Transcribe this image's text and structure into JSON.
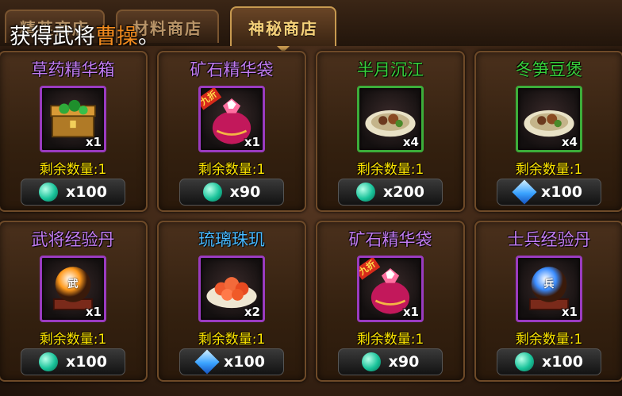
{
  "tabs": [
    "精英商店",
    "材料商店",
    "神秘商店"
  ],
  "toast": {
    "prefix": "获得武将",
    "highlight": "曹操",
    "suffix": "。"
  },
  "colors": {
    "purple": "#c27cf2",
    "green": "#39d13c",
    "blue": "#49b9ff",
    "remain": "#ffe600",
    "highlight": "#f08a1e"
  },
  "items": [
    {
      "name": "草药精华箱",
      "name_color": "#c27cf2",
      "qty": "x1",
      "remain": "剩余数量:1",
      "price": "x100",
      "currency": "jade-icon",
      "frame": "purple",
      "badge": "",
      "art": "chest-icon"
    },
    {
      "name": "矿石精华袋",
      "name_color": "#c27cf2",
      "qty": "x1",
      "remain": "剩余数量:1",
      "price": "x90",
      "currency": "jade-icon",
      "frame": "purple",
      "badge": "九折",
      "art": "bag-icon"
    },
    {
      "name": "半月沉江",
      "name_color": "#39d13c",
      "qty": "x4",
      "remain": "剩余数量:1",
      "price": "x200",
      "currency": "jade-icon",
      "frame": "green",
      "badge": "",
      "art": "dish-icon"
    },
    {
      "name": "冬笋豆煲",
      "name_color": "#39d13c",
      "qty": "x4",
      "remain": "剩余数量:1",
      "price": "x100",
      "currency": "gem-icon",
      "frame": "green",
      "badge": "",
      "art": "dish-icon"
    },
    {
      "name": "武将经验丹",
      "name_color": "#c27cf2",
      "qty": "x1",
      "remain": "剩余数量:1",
      "price": "x100",
      "currency": "jade-icon",
      "frame": "purple",
      "badge": "",
      "art": "orb-icon",
      "orb_char": "武",
      "orb_color": "#ff9a1c"
    },
    {
      "name": "琉璃珠玑",
      "name_color": "#49b9ff",
      "qty": "x2",
      "remain": "剩余数量:1",
      "price": "x100",
      "currency": "gem-icon",
      "frame": "purple",
      "badge": "",
      "art": "flower-dish-icon"
    },
    {
      "name": "矿石精华袋",
      "name_color": "#c27cf2",
      "qty": "x1",
      "remain": "剩余数量:1",
      "price": "x90",
      "currency": "jade-icon",
      "frame": "purple",
      "badge": "九折",
      "art": "bag-icon"
    },
    {
      "name": "士兵经验丹",
      "name_color": "#c27cf2",
      "qty": "x1",
      "remain": "剩余数量:1",
      "price": "x100",
      "currency": "jade-icon",
      "frame": "purple",
      "badge": "",
      "art": "orb-icon",
      "orb_char": "兵",
      "orb_color": "#3a8cff"
    }
  ]
}
